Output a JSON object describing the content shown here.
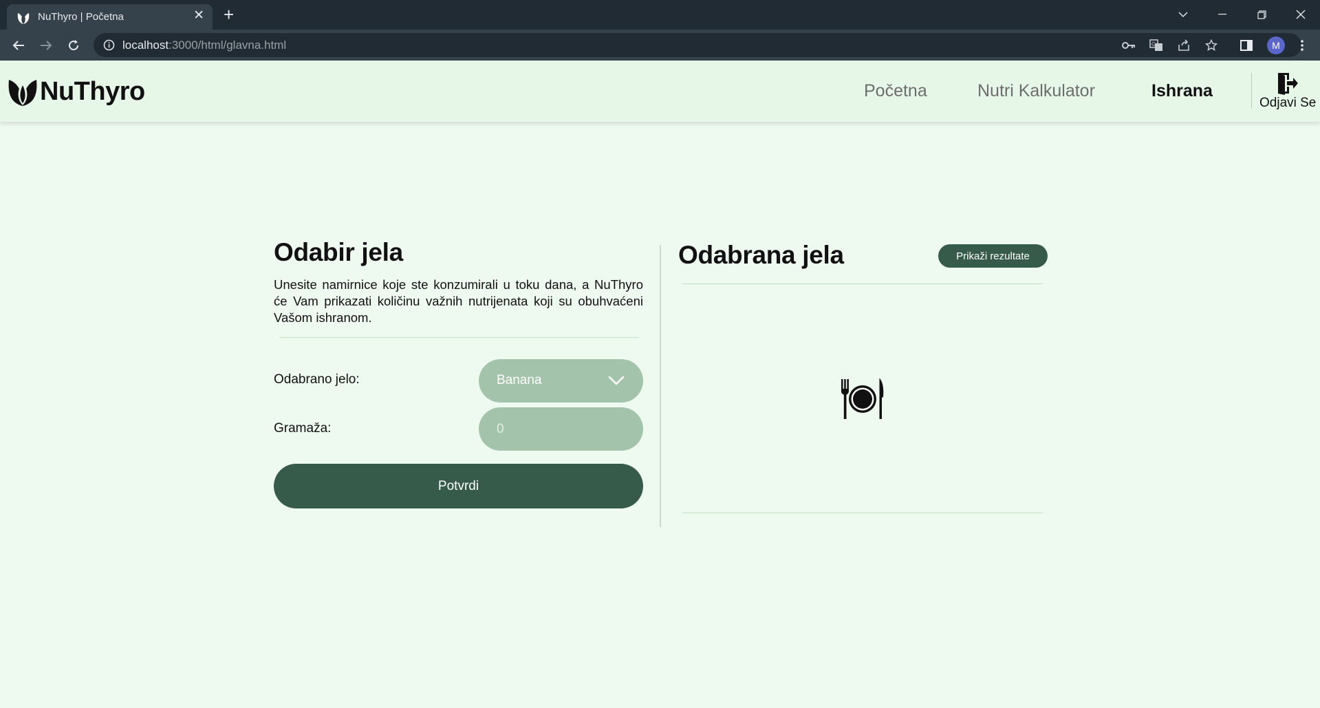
{
  "browser": {
    "tab_title": "NuThyro | Početna",
    "url_host": "localhost",
    "url_path": ":3000/html/glavna.html",
    "profile_initial": "M"
  },
  "header": {
    "brand": "NuThyro",
    "nav": [
      {
        "label": "Početna",
        "active": false
      },
      {
        "label": "Nutri Kalkulator",
        "active": false
      },
      {
        "label": "Ishrana",
        "active": true
      }
    ],
    "logout_label": "Odjavi Se"
  },
  "left": {
    "title": "Odabir jela",
    "intro": "Unesite namirnice koje ste konzumirali u toku dana, a NuThyro će Vam prikazati količinu važnih nutrijenata koji su obuhvaćeni Vašom ishranom.",
    "dish_label": "Odabrano jelo:",
    "dish_selected": "Banana",
    "grams_label": "Gramaža:",
    "grams_placeholder": "0",
    "confirm_label": "Potvrdi"
  },
  "right": {
    "title": "Odabrana jela",
    "results_button": "Prikaži rezultate"
  },
  "colors": {
    "page_bg": "#eef9f0",
    "header_bg": "#e6f7e8",
    "accent_dark": "#375b4a",
    "field_bg": "#a3c4aa"
  }
}
